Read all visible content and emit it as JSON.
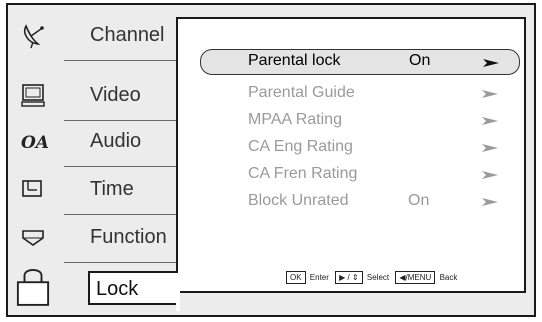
{
  "sidebar": {
    "items": [
      {
        "label": "Channel",
        "icon": "satellite-dish-icon"
      },
      {
        "label": "Video",
        "icon": "monitor-icon"
      },
      {
        "label": "Audio",
        "icon": "audio-icon"
      },
      {
        "label": "Time",
        "icon": "clock-icon"
      },
      {
        "label": "Function",
        "icon": "function-icon"
      },
      {
        "label": "Lock",
        "icon": "padlock-icon"
      }
    ],
    "selected": "Lock"
  },
  "menu": {
    "rows": [
      {
        "label": "Parental lock",
        "value": "On",
        "highlighted": true
      },
      {
        "label": "Parental Guide",
        "value": ""
      },
      {
        "label": "MPAA Rating",
        "value": ""
      },
      {
        "label": "CA Eng Rating",
        "value": ""
      },
      {
        "label": "CA Fren Rating",
        "value": ""
      },
      {
        "label": "Block Unrated",
        "value": "On"
      }
    ]
  },
  "footer": {
    "ok_key": "OK",
    "enter_label": "Enter",
    "select_key": "▶ / ⇕",
    "select_label": "Select",
    "back_key": "◀/MENU",
    "back_label": "Back"
  }
}
